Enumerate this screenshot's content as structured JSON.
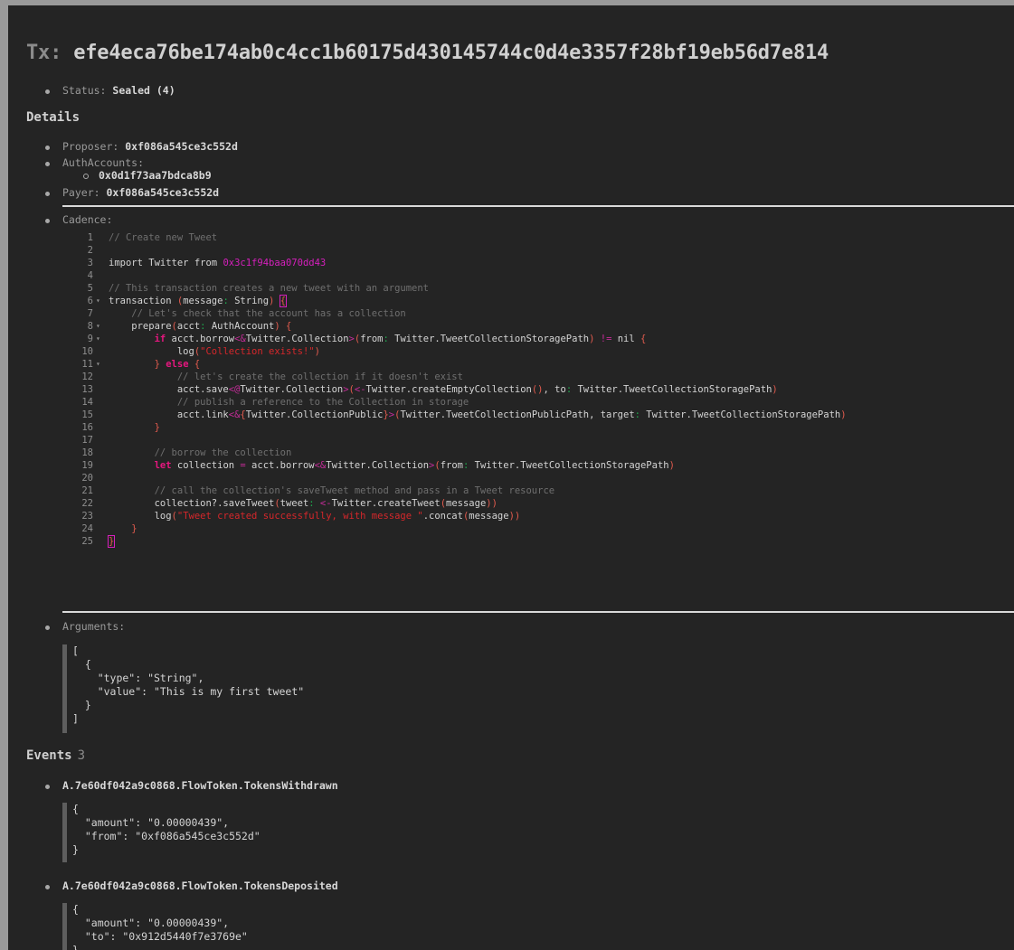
{
  "tx": {
    "prefix": "Tx:",
    "hash": "efe4eca76be174ab0c4cc1b60175d430145744c0d4e3357f28bf19eb56d7e814"
  },
  "status": {
    "label": "Status:",
    "value": "Sealed (4)"
  },
  "details": {
    "heading": "Details",
    "proposer_label": "Proposer:",
    "proposer": "0xf086a545ce3c552d",
    "auth_label": "AuthAccounts:",
    "auth_accounts": [
      "0x0d1f73aa7bdca8b9"
    ],
    "payer_label": "Payer:",
    "payer": "0xf086a545ce3c552d",
    "cadence_label": "Cadence:",
    "arguments_label": "Arguments:"
  },
  "code_lines": [
    {
      "n": "1",
      "fold": false,
      "html": "<span class='c-com'>// Create new Tweet</span>"
    },
    {
      "n": "2",
      "fold": false,
      "html": ""
    },
    {
      "n": "3",
      "fold": false,
      "html": "import Twitter from <span class='c-addr'>0x3c1f94baa070dd43</span>"
    },
    {
      "n": "4",
      "fold": false,
      "html": ""
    },
    {
      "n": "5",
      "fold": false,
      "html": "<span class='c-com'>// This transaction creates a new tweet with an argument</span>"
    },
    {
      "n": "6",
      "fold": true,
      "html": "transaction <span class='c-pun'>(</span>message<span class='c-g'>:</span> String<span class='c-pun'>)</span> <span class='c-pun brk'>{</span>"
    },
    {
      "n": "7",
      "fold": false,
      "html": "    <span class='c-com'>// Let's check that the account has a collection</span>"
    },
    {
      "n": "8",
      "fold": true,
      "html": "    prepare<span class='c-pun'>(</span>acct<span class='c-g'>:</span> AuthAccount<span class='c-pun'>)</span> <span class='c-pun'>{</span>"
    },
    {
      "n": "9",
      "fold": true,
      "html": "        <span class='c-kw'>if</span> acct.borrow<span class='c-op'>&lt;&amp;</span>Twitter.Collection<span class='c-op'>&gt;</span><span class='c-pun'>(</span>from<span class='c-g'>:</span> Twitter.TweetCollectionStoragePath<span class='c-pun'>)</span> <span class='c-op'>!=</span> nil <span class='c-pun'>{</span>"
    },
    {
      "n": "10",
      "fold": false,
      "html": "            log<span class='c-pun'>(</span><span class='c-str'>\"Collection exists!\"</span><span class='c-pun'>)</span>"
    },
    {
      "n": "11",
      "fold": true,
      "html": "        <span class='c-pun'>}</span> <span class='c-kw'>else</span> <span class='c-pun'>{</span>"
    },
    {
      "n": "12",
      "fold": false,
      "html": "            <span class='c-com'>// let's create the collection if it doesn't exist</span>"
    },
    {
      "n": "13",
      "fold": false,
      "html": "            acct.save<span class='c-op'>&lt;@</span>Twitter.Collection<span class='c-op'>&gt;</span><span class='c-pun'>(</span><span class='c-op'>&lt;-</span>Twitter.createEmptyCollection<span class='c-pun'>()</span>, to<span class='c-g'>:</span> Twitter.TweetCollectionStoragePath<span class='c-pun'>)</span>"
    },
    {
      "n": "14",
      "fold": false,
      "html": "            <span class='c-com'>// publish a reference to the Collection in storage</span>"
    },
    {
      "n": "15",
      "fold": false,
      "html": "            acct.link<span class='c-op'>&lt;&amp;</span><span class='c-pun'>{</span>Twitter.CollectionPublic<span class='c-pun'>}</span><span class='c-op'>&gt;</span><span class='c-pun'>(</span>Twitter.TweetCollectionPublicPath, target<span class='c-g'>:</span> Twitter.TweetCollectionStoragePath<span class='c-pun'>)</span>"
    },
    {
      "n": "16",
      "fold": false,
      "html": "        <span class='c-pun'>}</span>"
    },
    {
      "n": "17",
      "fold": false,
      "html": ""
    },
    {
      "n": "18",
      "fold": false,
      "html": "        <span class='c-com'>// borrow the collection</span>"
    },
    {
      "n": "19",
      "fold": false,
      "html": "        <span class='c-kw'>let</span> collection <span class='c-op'>=</span> acct.borrow<span class='c-op'>&lt;&amp;</span>Twitter.Collection<span class='c-op'>&gt;</span><span class='c-pun'>(</span>from<span class='c-g'>:</span> Twitter.TweetCollectionStoragePath<span class='c-pun'>)</span>"
    },
    {
      "n": "20",
      "fold": false,
      "html": ""
    },
    {
      "n": "21",
      "fold": false,
      "html": "        <span class='c-com'>// call the collection's saveTweet method and pass in a Tweet resource</span>"
    },
    {
      "n": "22",
      "fold": false,
      "html": "        collection?.saveTweet<span class='c-pun'>(</span>tweet<span class='c-g'>:</span> <span class='c-op'>&lt;-</span>Twitter.createTweet<span class='c-pun'>(</span>message<span class='c-pun'>))</span>"
    },
    {
      "n": "23",
      "fold": false,
      "html": "        log<span class='c-pun'>(</span><span class='c-str'>\"Tweet created successfully, with message \"</span>.concat<span class='c-pun'>(</span>message<span class='c-pun'>))</span>"
    },
    {
      "n": "24",
      "fold": false,
      "html": "    <span class='c-pun'>}</span>"
    },
    {
      "n": "25",
      "fold": false,
      "html": "<span class='c-pun brk'>}</span>"
    }
  ],
  "arguments_json": "[\n  {\n    \"type\": \"String\",\n    \"value\": \"This is my first tweet\"\n  }\n]",
  "events": {
    "heading": "Events",
    "count": "3",
    "items": [
      {
        "name": "A.7e60df042a9c0868.FlowToken.TokensWithdrawn",
        "json": "{\n  \"amount\": \"0.00000439\",\n  \"from\": \"0xf086a545ce3c552d\"\n}"
      },
      {
        "name": "A.7e60df042a9c0868.FlowToken.TokensDeposited",
        "json": "{\n  \"amount\": \"0.00000439\",\n  \"to\": \"0x912d5440f7e3769e\"\n}"
      }
    ]
  }
}
